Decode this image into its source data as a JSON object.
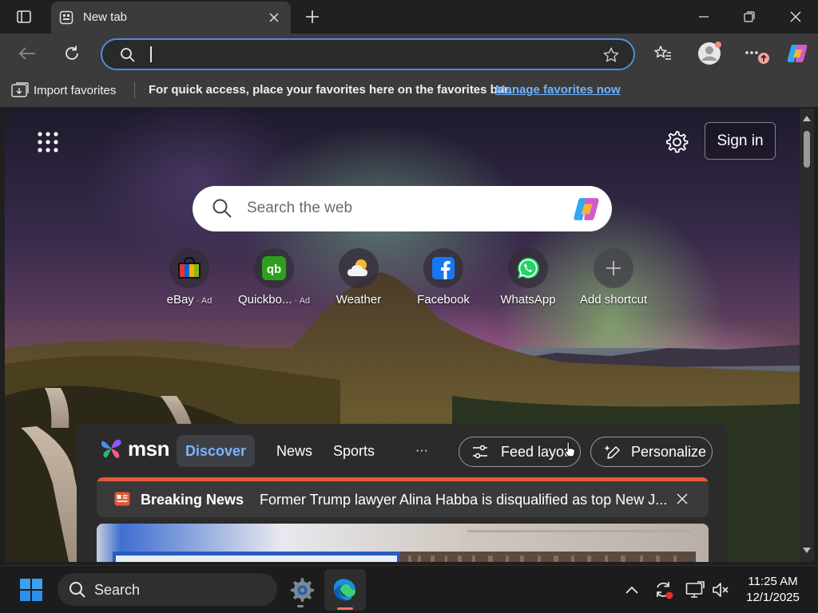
{
  "window": {
    "tab_title": "New tab"
  },
  "favorites_bar": {
    "import_label": "Import favorites",
    "message": "For quick access, place your favorites here on the favorites bar.",
    "manage_link": "Manage favorites now"
  },
  "newtab": {
    "sign_in_label": "Sign in",
    "search_placeholder": "Search the web",
    "shortcuts": [
      {
        "label": "eBay",
        "ad": "· Ad",
        "icon": "ebay-icon"
      },
      {
        "label": "Quickbo...",
        "ad": "· Ad",
        "icon": "quickbooks-icon"
      },
      {
        "label": "Weather",
        "ad": "",
        "icon": "weather-icon"
      },
      {
        "label": "Facebook",
        "ad": "",
        "icon": "facebook-icon"
      },
      {
        "label": "WhatsApp",
        "ad": "",
        "icon": "whatsapp-icon"
      },
      {
        "label": "Add shortcut",
        "ad": "",
        "icon": "plus-icon"
      }
    ]
  },
  "feed": {
    "brand": "msn",
    "tabs": [
      "Discover",
      "News",
      "Sports"
    ],
    "more_label": "···",
    "feed_layout_label": "Feed layout",
    "personalize_label": "Personalize",
    "breaking_label": "Breaking News",
    "breaking_headline": "Former Trump lawyer Alina Habba is disqualified as top New J..."
  },
  "taskbar": {
    "search_label": "Search",
    "time": "11:25 AM",
    "date": "12/1/2025"
  },
  "colors": {
    "accent": "#4a8fe0",
    "link": "#6fb3ff",
    "breaking_red": "#e25a3a",
    "discover_blue": "#7ab4ff"
  }
}
